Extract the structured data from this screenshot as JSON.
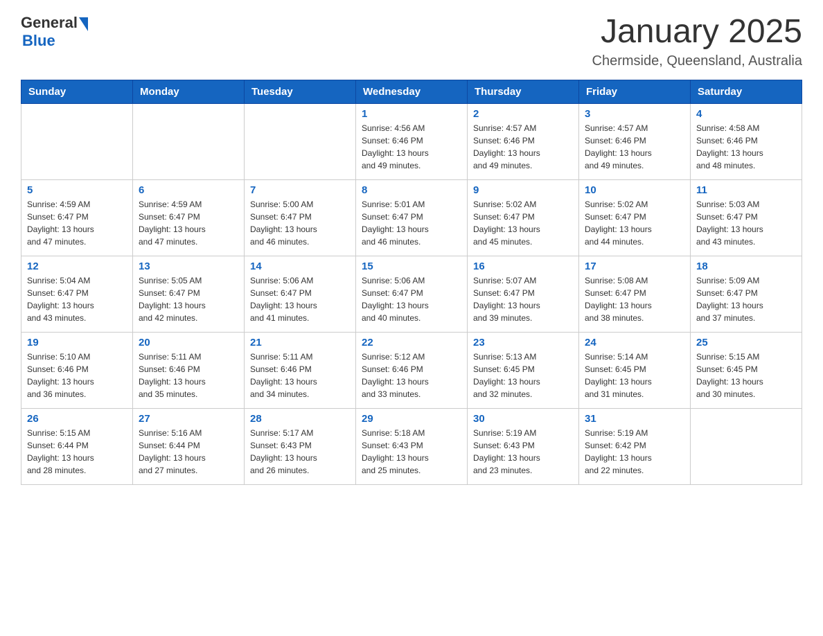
{
  "header": {
    "logo": {
      "general": "General",
      "triangle": "▶",
      "blue": "Blue"
    },
    "title": "January 2025",
    "subtitle": "Chermside, Queensland, Australia"
  },
  "calendar": {
    "headers": [
      "Sunday",
      "Monday",
      "Tuesday",
      "Wednesday",
      "Thursday",
      "Friday",
      "Saturday"
    ],
    "weeks": [
      [
        {
          "day": "",
          "info": ""
        },
        {
          "day": "",
          "info": ""
        },
        {
          "day": "",
          "info": ""
        },
        {
          "day": "1",
          "info": "Sunrise: 4:56 AM\nSunset: 6:46 PM\nDaylight: 13 hours\nand 49 minutes."
        },
        {
          "day": "2",
          "info": "Sunrise: 4:57 AM\nSunset: 6:46 PM\nDaylight: 13 hours\nand 49 minutes."
        },
        {
          "day": "3",
          "info": "Sunrise: 4:57 AM\nSunset: 6:46 PM\nDaylight: 13 hours\nand 49 minutes."
        },
        {
          "day": "4",
          "info": "Sunrise: 4:58 AM\nSunset: 6:46 PM\nDaylight: 13 hours\nand 48 minutes."
        }
      ],
      [
        {
          "day": "5",
          "info": "Sunrise: 4:59 AM\nSunset: 6:47 PM\nDaylight: 13 hours\nand 47 minutes."
        },
        {
          "day": "6",
          "info": "Sunrise: 4:59 AM\nSunset: 6:47 PM\nDaylight: 13 hours\nand 47 minutes."
        },
        {
          "day": "7",
          "info": "Sunrise: 5:00 AM\nSunset: 6:47 PM\nDaylight: 13 hours\nand 46 minutes."
        },
        {
          "day": "8",
          "info": "Sunrise: 5:01 AM\nSunset: 6:47 PM\nDaylight: 13 hours\nand 46 minutes."
        },
        {
          "day": "9",
          "info": "Sunrise: 5:02 AM\nSunset: 6:47 PM\nDaylight: 13 hours\nand 45 minutes."
        },
        {
          "day": "10",
          "info": "Sunrise: 5:02 AM\nSunset: 6:47 PM\nDaylight: 13 hours\nand 44 minutes."
        },
        {
          "day": "11",
          "info": "Sunrise: 5:03 AM\nSunset: 6:47 PM\nDaylight: 13 hours\nand 43 minutes."
        }
      ],
      [
        {
          "day": "12",
          "info": "Sunrise: 5:04 AM\nSunset: 6:47 PM\nDaylight: 13 hours\nand 43 minutes."
        },
        {
          "day": "13",
          "info": "Sunrise: 5:05 AM\nSunset: 6:47 PM\nDaylight: 13 hours\nand 42 minutes."
        },
        {
          "day": "14",
          "info": "Sunrise: 5:06 AM\nSunset: 6:47 PM\nDaylight: 13 hours\nand 41 minutes."
        },
        {
          "day": "15",
          "info": "Sunrise: 5:06 AM\nSunset: 6:47 PM\nDaylight: 13 hours\nand 40 minutes."
        },
        {
          "day": "16",
          "info": "Sunrise: 5:07 AM\nSunset: 6:47 PM\nDaylight: 13 hours\nand 39 minutes."
        },
        {
          "day": "17",
          "info": "Sunrise: 5:08 AM\nSunset: 6:47 PM\nDaylight: 13 hours\nand 38 minutes."
        },
        {
          "day": "18",
          "info": "Sunrise: 5:09 AM\nSunset: 6:47 PM\nDaylight: 13 hours\nand 37 minutes."
        }
      ],
      [
        {
          "day": "19",
          "info": "Sunrise: 5:10 AM\nSunset: 6:46 PM\nDaylight: 13 hours\nand 36 minutes."
        },
        {
          "day": "20",
          "info": "Sunrise: 5:11 AM\nSunset: 6:46 PM\nDaylight: 13 hours\nand 35 minutes."
        },
        {
          "day": "21",
          "info": "Sunrise: 5:11 AM\nSunset: 6:46 PM\nDaylight: 13 hours\nand 34 minutes."
        },
        {
          "day": "22",
          "info": "Sunrise: 5:12 AM\nSunset: 6:46 PM\nDaylight: 13 hours\nand 33 minutes."
        },
        {
          "day": "23",
          "info": "Sunrise: 5:13 AM\nSunset: 6:45 PM\nDaylight: 13 hours\nand 32 minutes."
        },
        {
          "day": "24",
          "info": "Sunrise: 5:14 AM\nSunset: 6:45 PM\nDaylight: 13 hours\nand 31 minutes."
        },
        {
          "day": "25",
          "info": "Sunrise: 5:15 AM\nSunset: 6:45 PM\nDaylight: 13 hours\nand 30 minutes."
        }
      ],
      [
        {
          "day": "26",
          "info": "Sunrise: 5:15 AM\nSunset: 6:44 PM\nDaylight: 13 hours\nand 28 minutes."
        },
        {
          "day": "27",
          "info": "Sunrise: 5:16 AM\nSunset: 6:44 PM\nDaylight: 13 hours\nand 27 minutes."
        },
        {
          "day": "28",
          "info": "Sunrise: 5:17 AM\nSunset: 6:43 PM\nDaylight: 13 hours\nand 26 minutes."
        },
        {
          "day": "29",
          "info": "Sunrise: 5:18 AM\nSunset: 6:43 PM\nDaylight: 13 hours\nand 25 minutes."
        },
        {
          "day": "30",
          "info": "Sunrise: 5:19 AM\nSunset: 6:43 PM\nDaylight: 13 hours\nand 23 minutes."
        },
        {
          "day": "31",
          "info": "Sunrise: 5:19 AM\nSunset: 6:42 PM\nDaylight: 13 hours\nand 22 minutes."
        },
        {
          "day": "",
          "info": ""
        }
      ]
    ]
  }
}
